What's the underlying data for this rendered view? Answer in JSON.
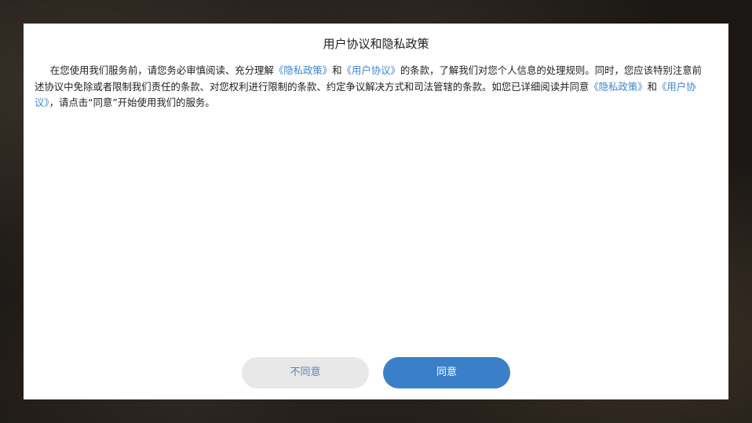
{
  "dialog": {
    "title": "用户协议和隐私政策",
    "text": {
      "part1": "在您使用我们服务前，请您务必审慎阅读、充分理解",
      "privacy_link_1": "《隐私政策》",
      "and_1": "和",
      "user_link_1": "《用户协议》",
      "part2": "的条款，了解我们对您个人信息的处理规则。同时，您应该特别注意前述协议中免除或者限制我们责任的条款、对您权利进行限制的条款、约定争议解决方式和司法管辖的条款。如您已详细阅读并同意",
      "privacy_link_2": "《隐私政策》",
      "and_2": "和",
      "user_link_2": "《用户协议》",
      "part3": "，请点击“同意”开始使用我们的服务。"
    },
    "buttons": {
      "disagree": "不同意",
      "agree": "同意"
    },
    "colors": {
      "link": "#3f86cf",
      "agree_bg": "#3a80c8",
      "disagree_bg": "#e8e8e8"
    }
  }
}
